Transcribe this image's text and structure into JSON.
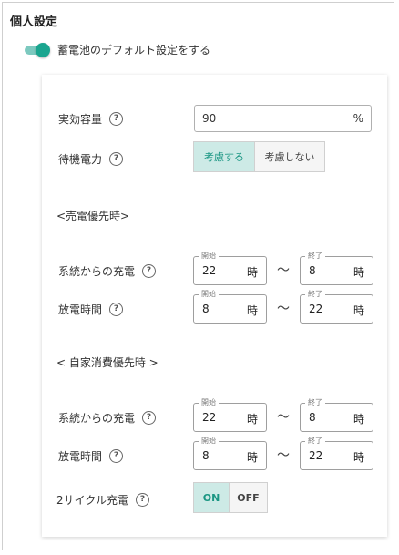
{
  "header": {
    "title": "個人設定"
  },
  "default_toggle": {
    "label": "蓄電池のデフォルト設定をする",
    "enabled": true
  },
  "accent_color": "#1aa58f",
  "form": {
    "capacity": {
      "label": "実効容量",
      "value": "90",
      "unit": "%"
    },
    "standby": {
      "label": "待機電力",
      "options": [
        "考慮する",
        "考慮しない"
      ],
      "selected": "考慮する"
    },
    "sell_priority": {
      "heading": "<売電優先時>",
      "grid_charge": {
        "label": "系統からの充電",
        "start_legend": "開始",
        "start": "22",
        "end_legend": "終了",
        "end": "8",
        "unit": "時"
      },
      "discharge": {
        "label": "放電時間",
        "start_legend": "開始",
        "start": "8",
        "end_legend": "終了",
        "end": "22",
        "unit": "時"
      }
    },
    "self_priority": {
      "heading": "< 自家消費優先時 >",
      "grid_charge": {
        "label": "系統からの充電",
        "start_legend": "開始",
        "start": "22",
        "end_legend": "終了",
        "end": "8",
        "unit": "時"
      },
      "discharge": {
        "label": "放電時間",
        "start_legend": "開始",
        "start": "8",
        "end_legend": "終了",
        "end": "22",
        "unit": "時"
      }
    },
    "two_cycle": {
      "label": "2サイクル充電",
      "options": [
        "ON",
        "OFF"
      ],
      "selected": "ON"
    },
    "range_separator": "〜",
    "help_glyph": "?"
  }
}
